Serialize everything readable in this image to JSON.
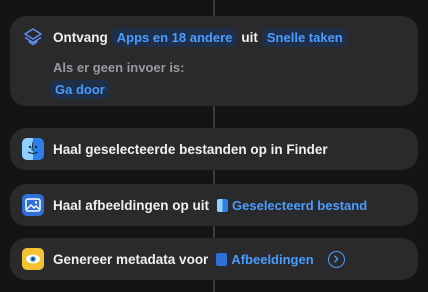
{
  "receive_card": {
    "label_receive": "Ontvang",
    "input_types": "Apps en 18 andere",
    "label_from": "uit",
    "source": "Snelle taken",
    "no_input_label": "Als er geen invoer is:",
    "no_input_action": "Ga door"
  },
  "actions": [
    {
      "label": "Haal geselecteerde bestanden op in Finder",
      "icon": "finder-icon"
    },
    {
      "label": "Haal afbeeldingen op uit",
      "icon": "image-icon",
      "token": "Geselecteerd bestand",
      "token_icon": "finder-mini-icon"
    },
    {
      "label": "Genereer metadata voor",
      "icon": "preview-icon",
      "token": "Afbeeldingen",
      "token_icon": "image-mini-icon",
      "expand_icon": "chevron-right-circle-icon"
    }
  ],
  "colors": {
    "background": "#141414",
    "card": "#2a2a2c",
    "accent": "#4a9cff",
    "muted_text": "#9a9a9e"
  }
}
